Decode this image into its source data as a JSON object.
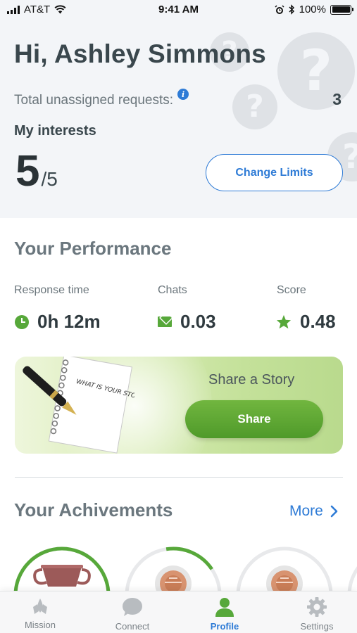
{
  "status_bar": {
    "carrier": "AT&T",
    "time": "9:41 AM",
    "battery_percent": "100%",
    "battery_level": 1.0
  },
  "header": {
    "greeting": "Hi, Ashley Simmons",
    "unassigned_label": "Total unassigned requests:",
    "unassigned_count": "3",
    "interests_title": "My interests",
    "interests_current": "5",
    "interests_total": "/5",
    "change_limits_label": "Change Limits"
  },
  "performance": {
    "title": "Your Performance",
    "metrics": [
      {
        "label": "Response time",
        "value": "0h 12m",
        "icon": "clock-icon"
      },
      {
        "label": "Chats",
        "value": "0.03",
        "icon": "mail-icon"
      },
      {
        "label": "Score",
        "value": "0.48",
        "icon": "star-icon"
      }
    ]
  },
  "story": {
    "notebook_text": "WHAT IS YOUR STORY?",
    "title": "Share a Story",
    "button_label": "Share"
  },
  "achievements": {
    "title": "Your Achivements",
    "more_label": "More",
    "items": [
      {
        "icon": "trophy-icon",
        "progress": 1.0
      },
      {
        "icon": "medal-icon",
        "progress": 0.3
      },
      {
        "icon": "medal-icon",
        "progress": 0.0
      }
    ]
  },
  "tab_bar": {
    "tabs": [
      {
        "label": "Mission",
        "icon": "mission-icon",
        "active": false
      },
      {
        "label": "Connect",
        "icon": "chat-icon",
        "active": false
      },
      {
        "label": "Profile",
        "icon": "profile-icon",
        "active": true
      },
      {
        "label": "Settings",
        "icon": "gear-icon",
        "active": false
      }
    ]
  },
  "colors": {
    "accent_blue": "#2e7bd6",
    "accent_green": "#57a83a",
    "header_bg": "#f3f5f8"
  }
}
